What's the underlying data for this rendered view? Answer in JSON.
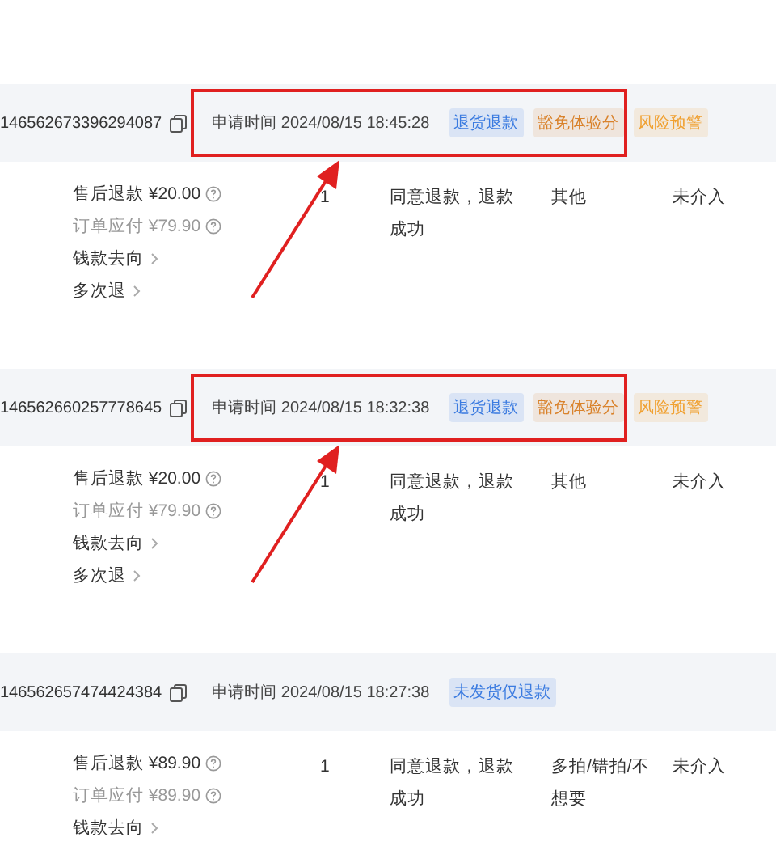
{
  "orders": [
    {
      "order_id": "146562673396294087",
      "apply_time": "申请时间 2024/08/15 18:45:28",
      "annotated": true,
      "tags": [
        {
          "text": "退货退款",
          "color": "#3b7be0"
        },
        {
          "text": "豁免体验分",
          "color": "#d9822b"
        },
        {
          "text": "风险预警",
          "color": "#f0a030"
        }
      ],
      "refund": "售后退款 ¥20.00",
      "payable": "订单应付 ¥79.90",
      "links": [
        "钱款去向",
        "多次退"
      ],
      "quantity": "1",
      "status": "同意退款，退款成功",
      "reason": "其他",
      "intervention": "未介入"
    },
    {
      "order_id": "146562660257778645",
      "apply_time": "申请时间 2024/08/15 18:32:38",
      "annotated": true,
      "tags": [
        {
          "text": "退货退款",
          "color": "#3b7be0"
        },
        {
          "text": "豁免体验分",
          "color": "#d9822b"
        },
        {
          "text": "风险预警",
          "color": "#f0a030"
        }
      ],
      "refund": "售后退款 ¥20.00",
      "payable": "订单应付 ¥79.90",
      "links": [
        "钱款去向",
        "多次退"
      ],
      "quantity": "1",
      "status": "同意退款，退款成功",
      "reason": "其他",
      "intervention": "未介入"
    },
    {
      "order_id": "146562657474424384",
      "apply_time": "申请时间 2024/08/15 18:27:38",
      "annotated": false,
      "tags": [
        {
          "text": "未发货仅退款",
          "color": "#3b7be0"
        }
      ],
      "refund": "售后退款 ¥89.90",
      "payable": "订单应付 ¥89.90",
      "links": [
        "钱款去向"
      ],
      "quantity": "1",
      "status": "同意退款，退款成功",
      "reason": "多拍/错拍/不想要",
      "intervention": "未介入"
    }
  ]
}
